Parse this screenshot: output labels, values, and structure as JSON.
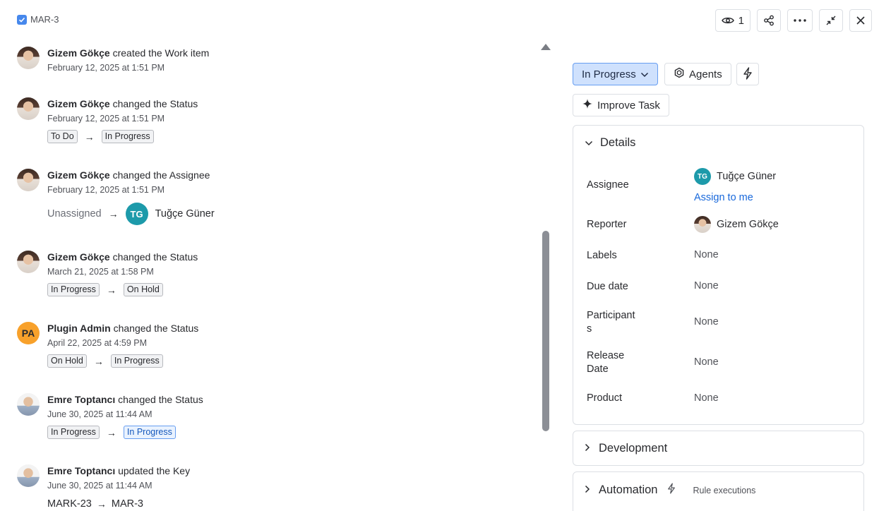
{
  "breadcrumb": {
    "key": "MAR-3"
  },
  "toolbar": {
    "watch_count": "1"
  },
  "feed": [
    {
      "actor": "Gizem Gökçe",
      "verb": "created the",
      "field": "Work item",
      "time": "February 12, 2025 at 1:51 PM"
    },
    {
      "actor": "Gizem Gökçe",
      "verb": "changed the",
      "field": "Status",
      "time": "February 12, 2025 at 1:51 PM",
      "from": "To Do",
      "to": "In Progress"
    },
    {
      "actor": "Gizem Gökçe",
      "verb": "changed the",
      "field": "Assignee",
      "time": "February 12, 2025 at 1:51 PM",
      "from": "Unassigned",
      "to_initials": "TG",
      "to": "Tuğçe Güner"
    },
    {
      "actor": "Gizem Gökçe",
      "verb": "changed the",
      "field": "Status",
      "time": "March 21, 2025 at 1:58 PM",
      "from": "In Progress",
      "to": "On Hold"
    },
    {
      "actor": "Plugin Admin",
      "initials": "PA",
      "verb": "changed the",
      "field": "Status",
      "time": "April 22, 2025 at 4:59 PM",
      "from": "On Hold",
      "to": "In Progress"
    },
    {
      "actor": "Emre Toptancı",
      "verb": "changed the",
      "field": "Status",
      "time": "June 30, 2025 at 11:44 AM",
      "from": "In Progress",
      "to": "In Progress"
    },
    {
      "actor": "Emre Toptancı",
      "verb": "updated the",
      "field": "Key",
      "time": "June 30, 2025 at 11:44 AM",
      "from": "MARK-23",
      "to": "MAR-3"
    }
  ],
  "arrow": "→",
  "side": {
    "status": "In Progress",
    "agents": "Agents",
    "improve": "Improve Task",
    "details_title": "Details",
    "assignee_label": "Assignee",
    "assignee_initials": "TG",
    "assignee_value": "Tuğçe Güner",
    "assign_to_me": "Assign to me",
    "reporter_label": "Reporter",
    "reporter_value": "Gizem Gökçe",
    "labels_label": "Labels",
    "labels_value": "None",
    "due_label": "Due date",
    "due_value": "None",
    "participants_label": "Participant\ns",
    "participants_value": "None",
    "release_label": "Release\nDate",
    "release_value": "None",
    "product_label": "Product",
    "product_value": "None",
    "development_title": "Development",
    "automation_title": "Automation",
    "rule_executions": "Rule executions"
  },
  "colors": {
    "accent": "#1868db",
    "status_bg": "#cfe1fd",
    "status_border": "#669df1"
  }
}
